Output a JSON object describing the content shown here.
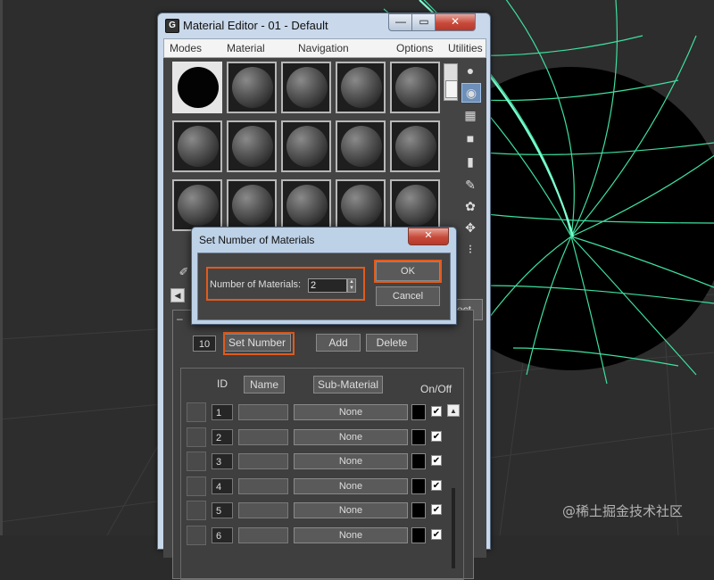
{
  "material_editor": {
    "title": "Material Editor - 01 - Default",
    "app_icon_glyph": "G",
    "window_controls": {
      "minimize": "—",
      "maximize": "▭",
      "close": "✕"
    },
    "menu": [
      "Modes",
      "Material",
      "Navigation",
      "Options",
      "Utilities"
    ],
    "side_tools": [
      "sample-type-sphere-icon",
      "backlight-icon",
      "background-checker-icon",
      "sample-uv-tiling-icon",
      "video-color-check-icon",
      "make-preview-icon",
      "options-icon",
      "select-by-material-icon",
      "material-map-navigator-icon"
    ],
    "select_button_fragment": "ect"
  },
  "multi_sub": {
    "num_field": "10",
    "set_number_label": "Set Number",
    "add_label": "Add",
    "delete_label": "Delete",
    "headers": {
      "id": "ID",
      "name": "Name",
      "sub_material": "Sub-Material",
      "on_off": "On/Off"
    },
    "rows": [
      {
        "id": "1",
        "sub": "None",
        "on": "✔"
      },
      {
        "id": "2",
        "sub": "None",
        "on": "✔"
      },
      {
        "id": "3",
        "sub": "None",
        "on": "✔"
      },
      {
        "id": "4",
        "sub": "None",
        "on": "✔"
      },
      {
        "id": "5",
        "sub": "None",
        "on": "✔"
      },
      {
        "id": "6",
        "sub": "None",
        "on": "✔"
      }
    ]
  },
  "dialog": {
    "title": "Set Number of Materials",
    "close_glyph": "✕",
    "label": "Number of Materials:",
    "value": "2",
    "ok_label": "OK",
    "cancel_label": "Cancel"
  },
  "colors": {
    "highlight": "#e25a1c",
    "viewport_wire": "#3ee0a0",
    "title_blue": "#c9d8ea"
  },
  "watermark": "@稀土掘金技术社区"
}
